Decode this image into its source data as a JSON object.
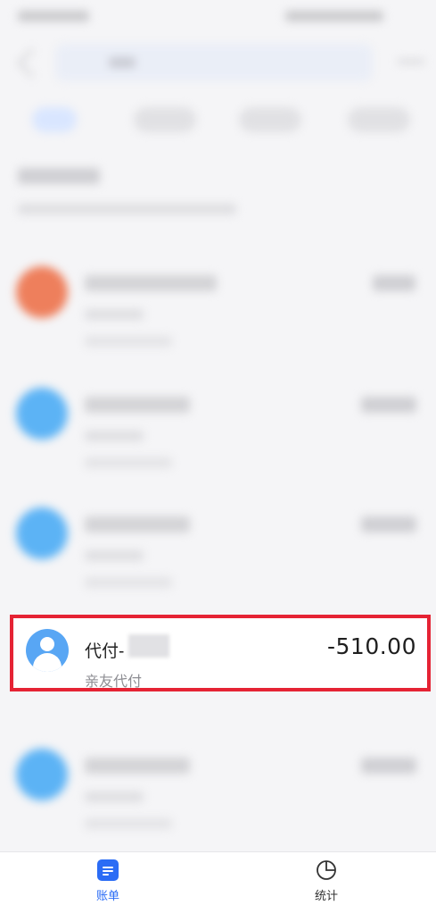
{
  "focused_record": {
    "name": "代付-",
    "amount": "-510.00",
    "category": "亲友代付"
  },
  "bottom_nav": [
    {
      "label": "账单",
      "icon": "bill-icon",
      "active": true
    },
    {
      "label": "统计",
      "icon": "pie-chart-icon",
      "active": false
    }
  ],
  "colors": {
    "accent": "#2b6cf5",
    "highlight_border": "#e52334",
    "avatar_orange": "#ee7f5c",
    "avatar_blue": "#5cb3f5"
  }
}
